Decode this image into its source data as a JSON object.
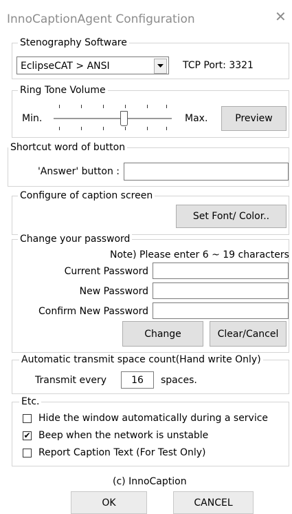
{
  "window": {
    "title": "InnoCaptionAgent Configuration",
    "close_glyph": "✕"
  },
  "steno": {
    "legend": "Stenography Software",
    "selected": "EclipseCAT > ANSI",
    "tcp_port_text": "TCP Port: 3321"
  },
  "ring": {
    "legend": "Ring Tone Volume",
    "min_label": "Min.",
    "max_label": "Max.",
    "preview_label": "Preview",
    "volume_fraction": 0.6
  },
  "shortcut": {
    "legend": "Shortcut word of button",
    "answer_label": "'Answer' button :",
    "answer_value": ""
  },
  "caption_screen": {
    "legend": "Configure of caption screen",
    "font_button": "Set Font/ Color.."
  },
  "password": {
    "legend": "Change your password",
    "note": "Note) Please enter 6 ~ 19 characters",
    "current_label": "Current Password",
    "new_label": "New Password",
    "confirm_label": "Confirm New Password",
    "change_button": "Change",
    "clear_button": "Clear/Cancel"
  },
  "transmit": {
    "legend": "Automatic transmit space count(Hand write Only)",
    "prefix": "Transmit every",
    "value": "16",
    "suffix": "spaces."
  },
  "etc": {
    "legend": "Etc.",
    "options": [
      {
        "label": "Hide the window automatically during a service",
        "checked": false
      },
      {
        "label": "Beep when the network is unstable",
        "checked": true
      },
      {
        "label": "Report Caption Text (For Test Only)",
        "checked": false
      }
    ]
  },
  "footer": {
    "copyright": "(c) InnoCaption",
    "ok_label": "OK",
    "cancel_label": "CANCEL"
  }
}
